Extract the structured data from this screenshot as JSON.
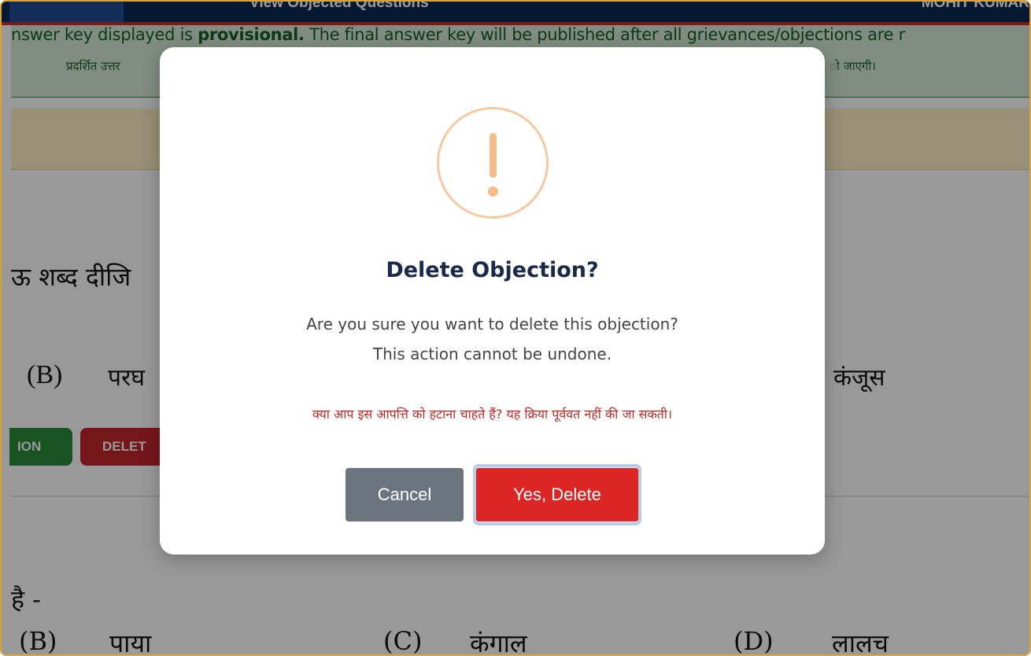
{
  "topbar": {
    "nav_label": "View Objected Questions",
    "user_label": "MOHIT KUMAR"
  },
  "notice": {
    "en_prefix": "nswer key displayed is ",
    "en_bold": "provisional.",
    "en_suffix": " The final answer key will be published after all grievances/objections are r",
    "hi_prefix": "प्रदर्शित उत्तर",
    "hi_suffix": "ो जाएगी।"
  },
  "question1": {
    "text_fragment": "ऊ शब्द दीजि",
    "option_b_letter": "(B)",
    "option_b_text": "परघ",
    "option_d_text": "कंजूस",
    "edit_button": "ION",
    "delete_button": "DELET"
  },
  "question2": {
    "text_fragment": "है -",
    "option_b_letter": "(B)",
    "option_b_text": "पाया",
    "option_c_letter": "(C)",
    "option_c_text": "कंगाल",
    "option_d_letter": "(D)",
    "option_d_text": "लालच"
  },
  "modal": {
    "icon": "exclamation-warning-icon",
    "icon_color": "#f8bb86",
    "title": "Delete Objection?",
    "message_line1": "Are you sure you want to delete this objection?",
    "message_line2": "This action cannot be undone.",
    "message_hindi": "क्या आप इस आपत्ति को हटाना चाहते हैं? यह क्रिया पूर्ववत नहीं की जा सकती।",
    "cancel_label": "Cancel",
    "confirm_label": "Yes, Delete",
    "cancel_color": "#6c757d",
    "confirm_color": "#dc2626"
  }
}
